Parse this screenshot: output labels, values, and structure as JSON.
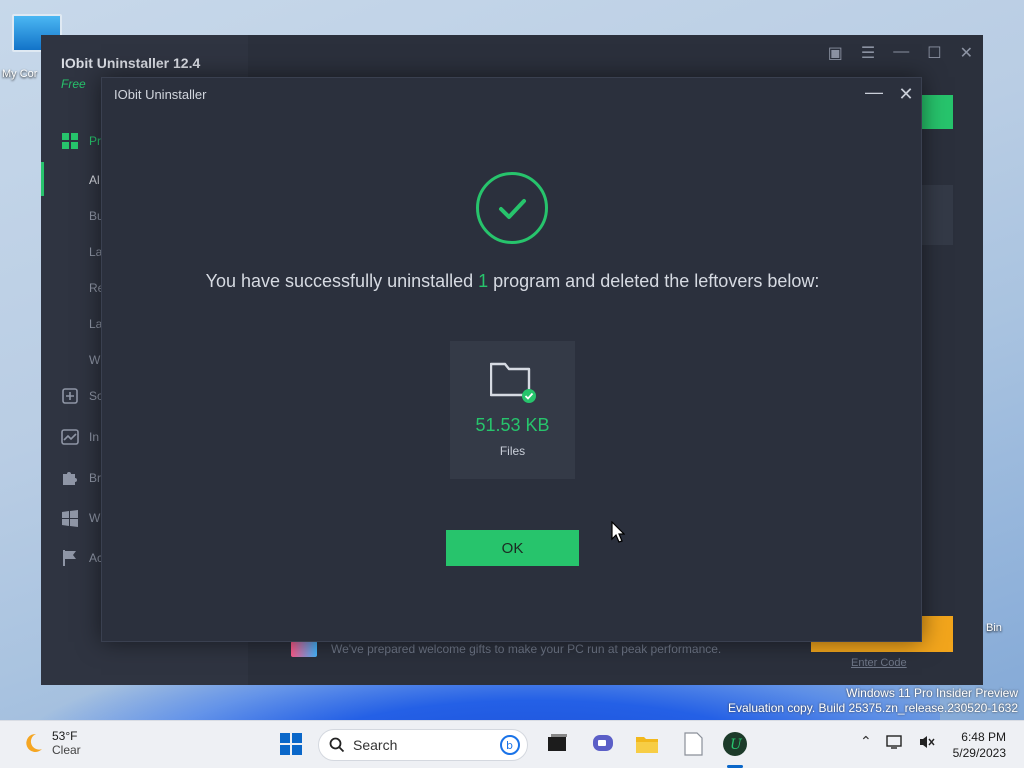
{
  "desktop": {
    "icon_my_computer_label": "My Cor",
    "icon_recycle_label": "Bin",
    "watermark_line1": "Windows 11 Pro Insider Preview",
    "watermark_line2": "Evaluation copy. Build 25375.zn_release.230520-1632"
  },
  "app": {
    "title": "IObit Uninstaller 12.4",
    "edition": "Free",
    "side_items": [
      {
        "label": "Pr",
        "icon": "grid-icon"
      },
      {
        "label": "Al",
        "icon": ""
      },
      {
        "label": "Bu",
        "icon": ""
      },
      {
        "label": "La",
        "icon": ""
      },
      {
        "label": "Re",
        "icon": ""
      },
      {
        "label": "La",
        "icon": ""
      },
      {
        "label": "W",
        "icon": ""
      },
      {
        "label": "So",
        "icon": "software-icon"
      },
      {
        "label": "In",
        "icon": "chart-icon"
      },
      {
        "label": "Br",
        "icon": "puzzle-icon"
      },
      {
        "label": "W",
        "icon": "windows-icon"
      },
      {
        "label": "Ac",
        "icon": "flag-icon"
      }
    ],
    "gift_text": "We've prepared welcome gifts to make your PC run at peak performance.",
    "enter_code": "Enter Code"
  },
  "dialog": {
    "title": "IObit Uninstaller",
    "message_before": "You have successfully uninstalled ",
    "message_count": "1",
    "message_after": " program and deleted the leftovers below:",
    "files_size": "51.53 KB",
    "files_label": "Files",
    "ok_label": "OK"
  },
  "taskbar": {
    "weather_temp": "53°F",
    "weather_condition": "Clear",
    "search_label": "Search",
    "time": "6:48 PM",
    "date": "5/29/2023"
  },
  "colors": {
    "accent_green": "#27c46c",
    "dialog_bg": "#2b303d",
    "app_bg": "#2b303c"
  }
}
